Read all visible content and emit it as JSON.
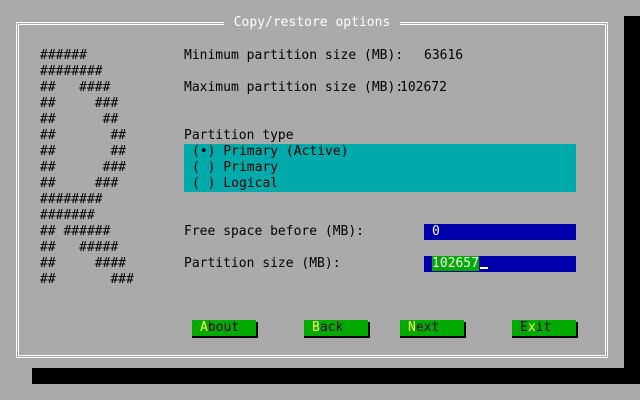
{
  "dialog": {
    "title": "Copy/restore options",
    "logo_art": "######\n########\n##   ####\n##     ###\n##      ##\n##       ##\n##       ##\n##      ###\n##     ###\n########\n#######\n## ######\n##   #####\n##     ####\n##       ###"
  },
  "info": {
    "min_label": "Minimum partition size (MB):",
    "min_value": "63616",
    "max_label": "Maximum partition size (MB):",
    "max_value": "102672"
  },
  "partition_type": {
    "label": "Partition type",
    "options": [
      {
        "mark": "(•)",
        "text": "Primary (Active)"
      },
      {
        "mark": "( )",
        "text": "Primary"
      },
      {
        "mark": "( )",
        "text": "Logical"
      }
    ]
  },
  "free_space": {
    "label": "Free space before (MB):",
    "value": "0"
  },
  "partition_size": {
    "label": "Partition size (MB):",
    "value": "102657"
  },
  "buttons": {
    "about": {
      "hotkey": "A",
      "rest": "bout"
    },
    "back": {
      "hotkey": "B",
      "rest": "ack"
    },
    "next": {
      "hotkey": "N",
      "rest": "ext"
    },
    "exit": {
      "pre": "E",
      "hotkey": "x",
      "rest": "it"
    }
  },
  "colors": {
    "background": "#aaaaaa",
    "border": "#ffffff",
    "highlight": "#00aaaa",
    "input_bg": "#0000aa",
    "button_bg": "#00aa00",
    "hotkey": "#ffff55",
    "shadow": "#000000"
  }
}
